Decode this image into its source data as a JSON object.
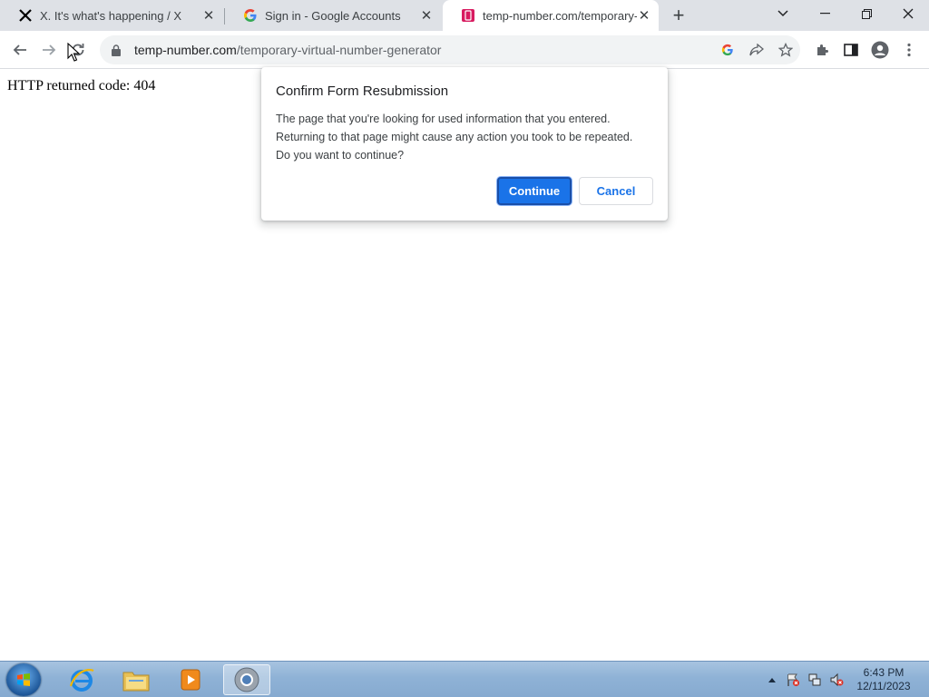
{
  "tabs": [
    {
      "title": "X. It's what's happening / X",
      "favicon": "x-logo-icon"
    },
    {
      "title": "Sign in - Google Accounts",
      "favicon": "google-g-icon"
    },
    {
      "title": "temp-number.com/temporary-v",
      "favicon": "temp-number-favicon",
      "active": true
    }
  ],
  "toolbar": {
    "url_host": "temp-number.com",
    "url_path": "/temporary-virtual-number-generator"
  },
  "page": {
    "body_text": "HTTP returned code: 404"
  },
  "dialog": {
    "title": "Confirm Form Resubmission",
    "message_line1": "The page that you're looking for used information that you entered.",
    "message_line2": "Returning to that page might cause any action you took to be repeated.",
    "message_line3": "Do you want to continue?",
    "continue_label": "Continue",
    "cancel_label": "Cancel"
  },
  "taskbar": {
    "time": "6:43 PM",
    "date": "12/11/2023"
  },
  "colors": {
    "accent": "#1a73e8",
    "tabstrip": "#dee1e6",
    "taskbar": "#8fb2d6"
  }
}
